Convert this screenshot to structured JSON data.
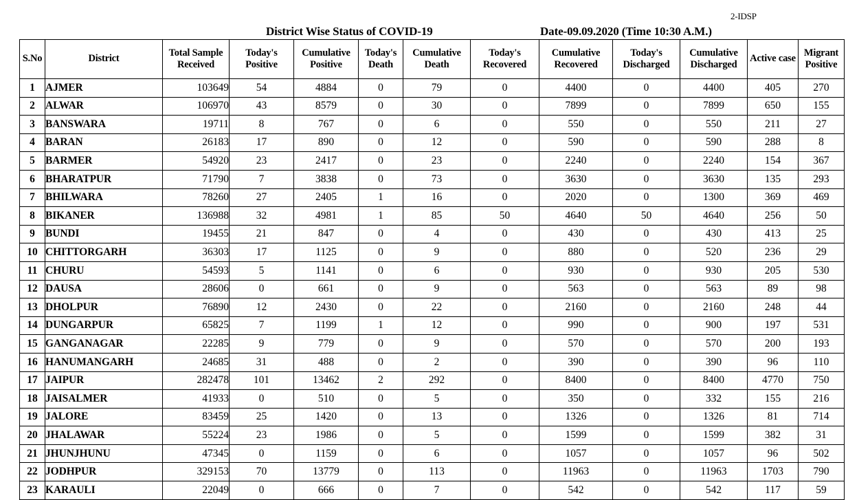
{
  "document": {
    "tag": "2-IDSP",
    "title": "District Wise Status of  COVID-19",
    "date": "Date-09.09.2020 (Time 10:30 A.M.)"
  },
  "table": {
    "columns": [
      {
        "key": "sno",
        "label": "S.No",
        "lines": [
          "S.No"
        ]
      },
      {
        "key": "district",
        "label": "District",
        "lines": [
          "District"
        ]
      },
      {
        "key": "total_sample_received",
        "label": "Total Sample Received",
        "lines": [
          "Total Sample",
          "Received"
        ]
      },
      {
        "key": "todays_positive",
        "label": "Today's Positive",
        "lines": [
          "Today's",
          "Positive"
        ]
      },
      {
        "key": "cumulative_positive",
        "label": "Cumulative Positive",
        "lines": [
          "Cumulative",
          "Positive"
        ]
      },
      {
        "key": "todays_death",
        "label": "Today's Death",
        "lines": [
          "Today's",
          "Death"
        ]
      },
      {
        "key": "cumulative_death",
        "label": "Cumulative Death",
        "lines": [
          "Cumulative",
          "Death"
        ]
      },
      {
        "key": "todays_recovered",
        "label": "Today's Recovered",
        "lines": [
          "Today's",
          "Recovered"
        ]
      },
      {
        "key": "cumulative_recovered",
        "label": "Cumulative Recovered",
        "lines": [
          "Cumulative",
          "Recovered"
        ]
      },
      {
        "key": "todays_discharged",
        "label": "Today's Discharged",
        "lines": [
          "Today's",
          "Discharged"
        ]
      },
      {
        "key": "cumulative_discharged",
        "label": "Cumulative Discharged",
        "lines": [
          "Cumulative",
          "Discharged"
        ]
      },
      {
        "key": "active_case",
        "label": "Active  case",
        "lines": [
          "Active  case"
        ]
      },
      {
        "key": "migrant_positive",
        "label": "Migrant Positive",
        "lines": [
          "Migrant",
          "Positive"
        ]
      }
    ],
    "rows": [
      {
        "sno": "1",
        "district": "AJMER",
        "total_sample_received": "103649",
        "todays_positive": "54",
        "cumulative_positive": "4884",
        "todays_death": "0",
        "cumulative_death": "79",
        "todays_recovered": "0",
        "cumulative_recovered": "4400",
        "todays_discharged": "0",
        "cumulative_discharged": "4400",
        "active_case": "405",
        "migrant_positive": "270"
      },
      {
        "sno": "2",
        "district": "ALWAR",
        "total_sample_received": "106970",
        "todays_positive": "43",
        "cumulative_positive": "8579",
        "todays_death": "0",
        "cumulative_death": "30",
        "todays_recovered": "0",
        "cumulative_recovered": "7899",
        "todays_discharged": "0",
        "cumulative_discharged": "7899",
        "active_case": "650",
        "migrant_positive": "155"
      },
      {
        "sno": "3",
        "district": "BANSWARA",
        "total_sample_received": "19711",
        "todays_positive": "8",
        "cumulative_positive": "767",
        "todays_death": "0",
        "cumulative_death": "6",
        "todays_recovered": "0",
        "cumulative_recovered": "550",
        "todays_discharged": "0",
        "cumulative_discharged": "550",
        "active_case": "211",
        "migrant_positive": "27"
      },
      {
        "sno": "4",
        "district": "BARAN",
        "total_sample_received": "26183",
        "todays_positive": "17",
        "cumulative_positive": "890",
        "todays_death": "0",
        "cumulative_death": "12",
        "todays_recovered": "0",
        "cumulative_recovered": "590",
        "todays_discharged": "0",
        "cumulative_discharged": "590",
        "active_case": "288",
        "migrant_positive": "8"
      },
      {
        "sno": "5",
        "district": "BARMER",
        "total_sample_received": "54920",
        "todays_positive": "23",
        "cumulative_positive": "2417",
        "todays_death": "0",
        "cumulative_death": "23",
        "todays_recovered": "0",
        "cumulative_recovered": "2240",
        "todays_discharged": "0",
        "cumulative_discharged": "2240",
        "active_case": "154",
        "migrant_positive": "367"
      },
      {
        "sno": "6",
        "district": "BHARATPUR",
        "total_sample_received": "71790",
        "todays_positive": "7",
        "cumulative_positive": "3838",
        "todays_death": "0",
        "cumulative_death": "73",
        "todays_recovered": "0",
        "cumulative_recovered": "3630",
        "todays_discharged": "0",
        "cumulative_discharged": "3630",
        "active_case": "135",
        "migrant_positive": "293"
      },
      {
        "sno": "7",
        "district": "BHILWARA",
        "total_sample_received": "78260",
        "todays_positive": "27",
        "cumulative_positive": "2405",
        "todays_death": "1",
        "cumulative_death": "16",
        "todays_recovered": "0",
        "cumulative_recovered": "2020",
        "todays_discharged": "0",
        "cumulative_discharged": "1300",
        "active_case": "369",
        "migrant_positive": "469"
      },
      {
        "sno": "8",
        "district": "BIKANER",
        "total_sample_received": "136988",
        "todays_positive": "32",
        "cumulative_positive": "4981",
        "todays_death": "1",
        "cumulative_death": "85",
        "todays_recovered": "50",
        "cumulative_recovered": "4640",
        "todays_discharged": "50",
        "cumulative_discharged": "4640",
        "active_case": "256",
        "migrant_positive": "50"
      },
      {
        "sno": "9",
        "district": "BUNDI",
        "total_sample_received": "19455",
        "todays_positive": "21",
        "cumulative_positive": "847",
        "todays_death": "0",
        "cumulative_death": "4",
        "todays_recovered": "0",
        "cumulative_recovered": "430",
        "todays_discharged": "0",
        "cumulative_discharged": "430",
        "active_case": "413",
        "migrant_positive": "25"
      },
      {
        "sno": "10",
        "district": "CHITTORGARH",
        "total_sample_received": "36303",
        "todays_positive": "17",
        "cumulative_positive": "1125",
        "todays_death": "0",
        "cumulative_death": "9",
        "todays_recovered": "0",
        "cumulative_recovered": "880",
        "todays_discharged": "0",
        "cumulative_discharged": "520",
        "active_case": "236",
        "migrant_positive": "29"
      },
      {
        "sno": "11",
        "district": "CHURU",
        "total_sample_received": "54593",
        "todays_positive": "5",
        "cumulative_positive": "1141",
        "todays_death": "0",
        "cumulative_death": "6",
        "todays_recovered": "0",
        "cumulative_recovered": "930",
        "todays_discharged": "0",
        "cumulative_discharged": "930",
        "active_case": "205",
        "migrant_positive": "530"
      },
      {
        "sno": "12",
        "district": "DAUSA",
        "total_sample_received": "28606",
        "todays_positive": "0",
        "cumulative_positive": "661",
        "todays_death": "0",
        "cumulative_death": "9",
        "todays_recovered": "0",
        "cumulative_recovered": "563",
        "todays_discharged": "0",
        "cumulative_discharged": "563",
        "active_case": "89",
        "migrant_positive": "98"
      },
      {
        "sno": "13",
        "district": "DHOLPUR",
        "total_sample_received": "76890",
        "todays_positive": "12",
        "cumulative_positive": "2430",
        "todays_death": "0",
        "cumulative_death": "22",
        "todays_recovered": "0",
        "cumulative_recovered": "2160",
        "todays_discharged": "0",
        "cumulative_discharged": "2160",
        "active_case": "248",
        "migrant_positive": "44"
      },
      {
        "sno": "14",
        "district": "DUNGARPUR",
        "total_sample_received": "65825",
        "todays_positive": "7",
        "cumulative_positive": "1199",
        "todays_death": "1",
        "cumulative_death": "12",
        "todays_recovered": "0",
        "cumulative_recovered": "990",
        "todays_discharged": "0",
        "cumulative_discharged": "900",
        "active_case": "197",
        "migrant_positive": "531"
      },
      {
        "sno": "15",
        "district": "GANGANAGAR",
        "total_sample_received": "22285",
        "todays_positive": "9",
        "cumulative_positive": "779",
        "todays_death": "0",
        "cumulative_death": "9",
        "todays_recovered": "0",
        "cumulative_recovered": "570",
        "todays_discharged": "0",
        "cumulative_discharged": "570",
        "active_case": "200",
        "migrant_positive": "193"
      },
      {
        "sno": "16",
        "district": "HANUMANGARH",
        "total_sample_received": "24685",
        "todays_positive": "31",
        "cumulative_positive": "488",
        "todays_death": "0",
        "cumulative_death": "2",
        "todays_recovered": "0",
        "cumulative_recovered": "390",
        "todays_discharged": "0",
        "cumulative_discharged": "390",
        "active_case": "96",
        "migrant_positive": "110"
      },
      {
        "sno": "17",
        "district": "JAIPUR",
        "total_sample_received": "282478",
        "todays_positive": "101",
        "cumulative_positive": "13462",
        "todays_death": "2",
        "cumulative_death": "292",
        "todays_recovered": "0",
        "cumulative_recovered": "8400",
        "todays_discharged": "0",
        "cumulative_discharged": "8400",
        "active_case": "4770",
        "migrant_positive": "750"
      },
      {
        "sno": "18",
        "district": "JAISALMER",
        "total_sample_received": "41933",
        "todays_positive": "0",
        "cumulative_positive": "510",
        "todays_death": "0",
        "cumulative_death": "5",
        "todays_recovered": "0",
        "cumulative_recovered": "350",
        "todays_discharged": "0",
        "cumulative_discharged": "332",
        "active_case": "155",
        "migrant_positive": "216"
      },
      {
        "sno": "19",
        "district": "JALORE",
        "total_sample_received": "83459",
        "todays_positive": "25",
        "cumulative_positive": "1420",
        "todays_death": "0",
        "cumulative_death": "13",
        "todays_recovered": "0",
        "cumulative_recovered": "1326",
        "todays_discharged": "0",
        "cumulative_discharged": "1326",
        "active_case": "81",
        "migrant_positive": "714"
      },
      {
        "sno": "20",
        "district": "JHALAWAR",
        "total_sample_received": "55224",
        "todays_positive": "23",
        "cumulative_positive": "1986",
        "todays_death": "0",
        "cumulative_death": "5",
        "todays_recovered": "0",
        "cumulative_recovered": "1599",
        "todays_discharged": "0",
        "cumulative_discharged": "1599",
        "active_case": "382",
        "migrant_positive": "31"
      },
      {
        "sno": "21",
        "district": "JHUNJHUNU",
        "total_sample_received": "47345",
        "todays_positive": "0",
        "cumulative_positive": "1159",
        "todays_death": "0",
        "cumulative_death": "6",
        "todays_recovered": "0",
        "cumulative_recovered": "1057",
        "todays_discharged": "0",
        "cumulative_discharged": "1057",
        "active_case": "96",
        "migrant_positive": "502"
      },
      {
        "sno": "22",
        "district": "JODHPUR",
        "total_sample_received": "329153",
        "todays_positive": "70",
        "cumulative_positive": "13779",
        "todays_death": "0",
        "cumulative_death": "113",
        "todays_recovered": "0",
        "cumulative_recovered": "11963",
        "todays_discharged": "0",
        "cumulative_discharged": "11963",
        "active_case": "1703",
        "migrant_positive": "790"
      },
      {
        "sno": "23",
        "district": "KARAULI",
        "total_sample_received": "22049",
        "todays_positive": "0",
        "cumulative_positive": "666",
        "todays_death": "0",
        "cumulative_death": "7",
        "todays_recovered": "0",
        "cumulative_recovered": "542",
        "todays_discharged": "0",
        "cumulative_discharged": "542",
        "active_case": "117",
        "migrant_positive": "59"
      }
    ]
  }
}
